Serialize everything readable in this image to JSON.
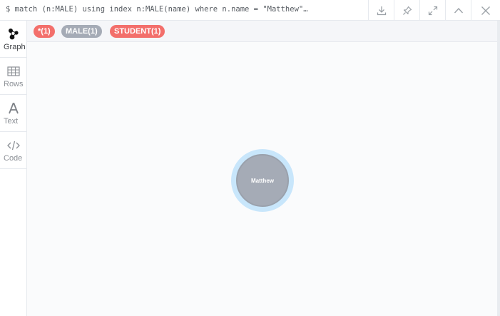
{
  "header": {
    "query": "$ match (n:MALE) using index n:MALE(name) where n.name = \"Matthew\"…",
    "buttons": [
      {
        "name": "download-icon"
      },
      {
        "name": "pin-icon"
      },
      {
        "name": "expand-icon"
      },
      {
        "name": "collapse-icon"
      },
      {
        "name": "close-icon"
      }
    ]
  },
  "sidebar": {
    "items": [
      {
        "label": "Graph",
        "icon": "graph-icon",
        "active": true
      },
      {
        "label": "Rows",
        "icon": "table-icon",
        "active": false
      },
      {
        "label": "Text",
        "icon": "text-icon",
        "active": false
      },
      {
        "label": "Code",
        "icon": "code-icon",
        "active": false
      }
    ]
  },
  "labels": [
    {
      "text": "*(1)",
      "color": "#f36f6b"
    },
    {
      "text": "MALE(1)",
      "color": "#a5abb6"
    },
    {
      "text": "STUDENT(1)",
      "color": "#f36f6b"
    }
  ],
  "graph": {
    "node_caption": "Matthew",
    "node_color": "#a5abb6",
    "halo_color": "#c8e6fb"
  }
}
